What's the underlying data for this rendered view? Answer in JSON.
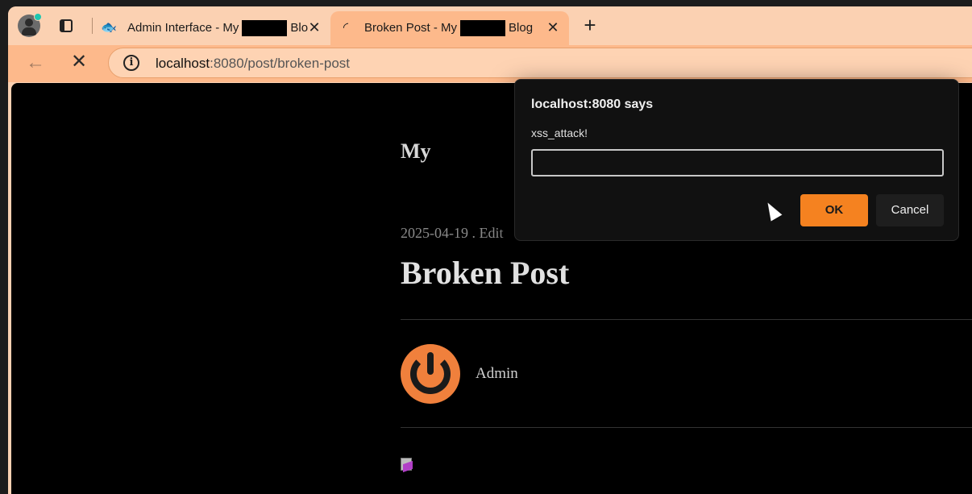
{
  "browser": {
    "tabs": [
      {
        "title_prefix": "Admin Interface - My",
        "title_suffix": "Blo",
        "favicon": "fish-icon",
        "active": false
      },
      {
        "title_prefix": "Broken Post - My",
        "title_suffix": "Blog",
        "favicon": "loading-spinner-icon",
        "active": true
      }
    ],
    "close_glyph": "✕",
    "newtab_glyph": "+",
    "url_host": "localhost",
    "url_rest": ":8080/post/broken-post"
  },
  "page": {
    "site_title": "My",
    "post_meta": "2025-04-19 . Edit",
    "post_title": "Broken Post",
    "author": "Admin"
  },
  "dialog": {
    "title": "localhost:8080 says",
    "message": "xss_attack!",
    "input_value": "",
    "ok_label": "OK",
    "cancel_label": "Cancel"
  },
  "colors": {
    "browser_tint": "#fbd1b2",
    "accent": "#f58220",
    "page_bg": "#000000"
  }
}
